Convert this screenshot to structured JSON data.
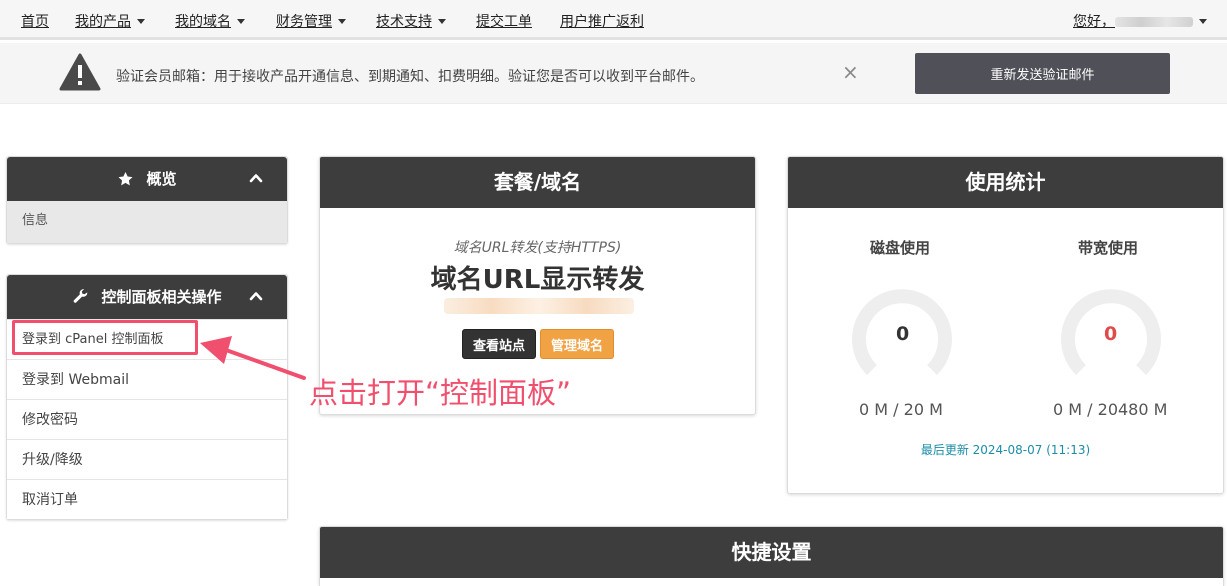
{
  "nav": {
    "items": [
      {
        "label": "首页",
        "dropdown": false
      },
      {
        "label": "我的产品",
        "dropdown": true
      },
      {
        "label": "我的域名",
        "dropdown": true
      },
      {
        "label": "财务管理",
        "dropdown": true
      },
      {
        "label": "技术支持",
        "dropdown": true
      },
      {
        "label": "提交工单",
        "dropdown": false
      },
      {
        "label": "用户推广返利",
        "dropdown": false
      }
    ],
    "greeting": "您好，"
  },
  "alert": {
    "icon": "warning-triangle-icon",
    "text": "验证会员邮箱：用于接收产品开通信息、到期通知、扣费明细。验证您是否可以收到平台邮件。",
    "close": "×",
    "button": "重新发送验证邮件"
  },
  "sidebar": {
    "overview": {
      "title": "概览",
      "icon": "star-icon",
      "items": [
        "信息"
      ]
    },
    "actions": {
      "title": "控制面板相关操作",
      "icon": "wrench-icon",
      "items": [
        "登录到 cPanel 控制面板",
        "登录到 Webmail",
        "修改密码",
        "升级/降级",
        "取消订单"
      ]
    }
  },
  "package": {
    "title": "套餐/域名",
    "subtitle": "域名URL转发(支持HTTPS)",
    "name": "域名URL显示转发",
    "btn_view": "查看站点",
    "btn_manage": "管理域名"
  },
  "usage": {
    "title": "使用统计",
    "disk": {
      "label": "磁盘使用",
      "value": "0",
      "caption": "0 M / 20 M",
      "value_color": "#333333"
    },
    "bandwidth": {
      "label": "带宽使用",
      "value": "0",
      "caption": "0 M / 20480 M",
      "value_color": "#e04a4a"
    },
    "last_update": "最后更新 2024-08-07 (11:13)"
  },
  "quick": {
    "title": "快捷设置"
  },
  "annotation": {
    "text": "点击打开“控制面板”",
    "color": "#f0506e"
  }
}
